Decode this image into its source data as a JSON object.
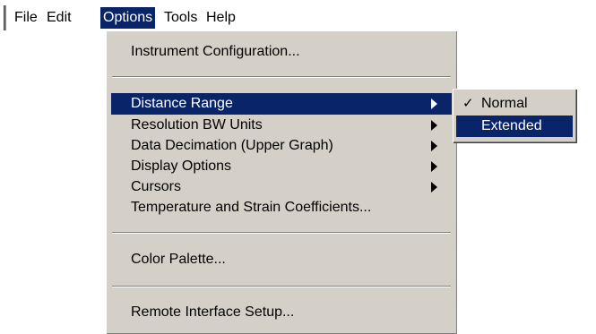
{
  "menubar": {
    "file": "File",
    "edit": "Edit",
    "options": "Options",
    "tools": "Tools",
    "help": "Help"
  },
  "options_menu": {
    "instrument_configuration": "Instrument Configuration...",
    "distance_range": "Distance Range",
    "resolution_bw_units": "Resolution BW Units",
    "data_decimation": "Data Decimation (Upper Graph)",
    "display_options": "Display Options",
    "cursors": "Cursors",
    "temperature_strain": "Temperature and Strain Coefficients...",
    "color_palette": "Color Palette...",
    "remote_interface_setup": "Remote Interface Setup..."
  },
  "distance_range_submenu": {
    "normal": "Normal",
    "normal_checked": true,
    "extended": "Extended"
  },
  "colors": {
    "menu_background": "#d4d0c8",
    "highlight": "#0a246a",
    "highlight_text": "#ffffff"
  },
  "icons": {
    "submenu_arrow": "submenu-arrow-icon",
    "check": "checkmark-icon"
  }
}
